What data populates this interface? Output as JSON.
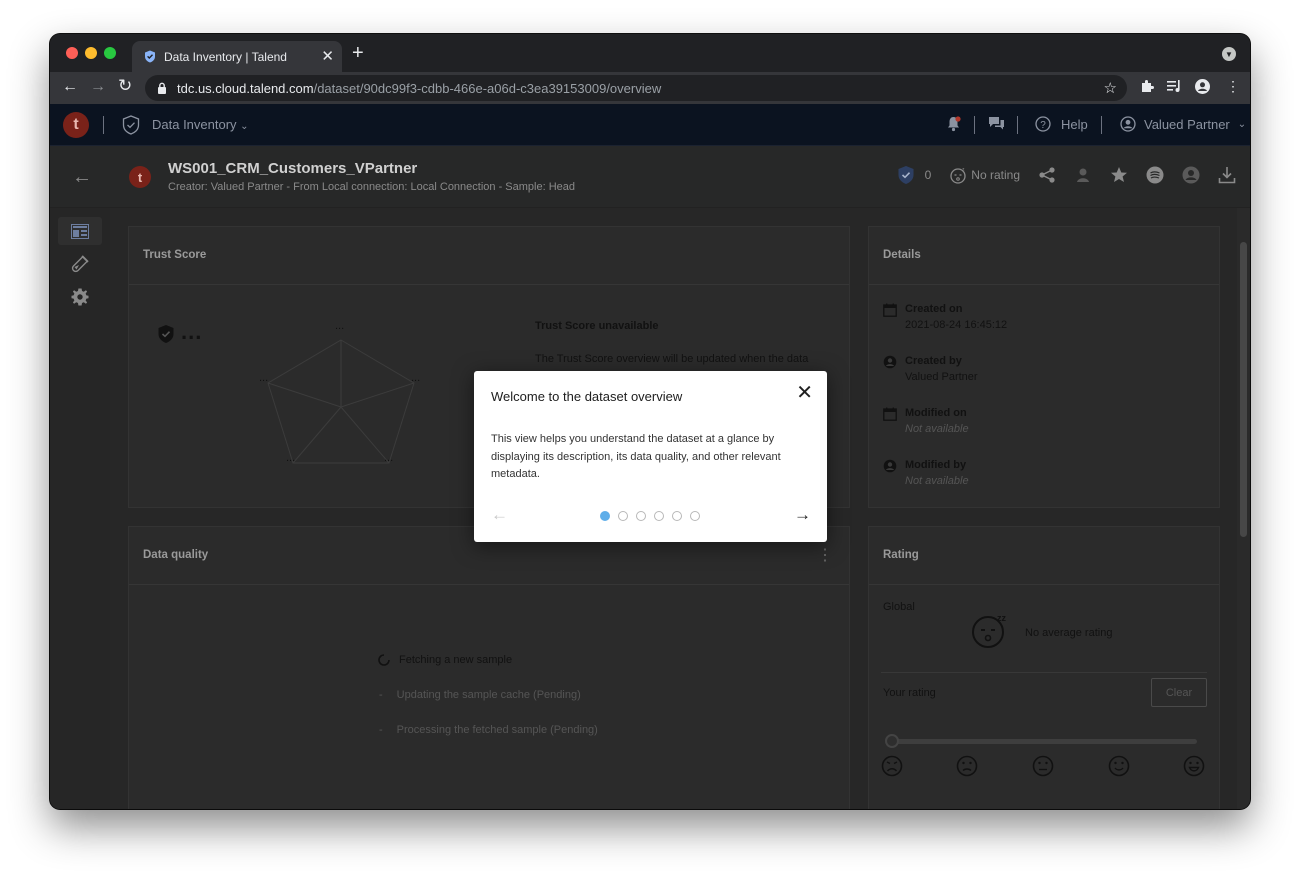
{
  "browser": {
    "tab_title": "Data Inventory | Talend",
    "url_host": "tdc.us.cloud.talend.com",
    "url_path": "/dataset/90dc99f3-cdbb-466e-a06d-c3ea39153009/overview",
    "traffic_lights": [
      "#fe5f57",
      "#febc2e",
      "#28c840"
    ]
  },
  "appbar": {
    "logo": "t",
    "app_name": "Data Inventory",
    "help": "Help",
    "user": "Valued Partner"
  },
  "dataset": {
    "logo": "t",
    "title": "WS001_CRM_Customers_VPartner",
    "subtitle": "Creator: Valued Partner - From Local connection: Local Connection - Sample: Head",
    "certification_count": "0",
    "rating": "No rating"
  },
  "trust_score": {
    "title": "Trust Score",
    "score": "...",
    "axis_values": [
      "...",
      "...",
      "...",
      "...",
      "..."
    ],
    "unavailable_title": "Trust Score unavailable",
    "unavailable_text": "The Trust Score overview will be updated when the data"
  },
  "details": {
    "title": "Details",
    "items": [
      {
        "label": "Created on",
        "value": "2021-08-24 16:45:12",
        "icon": "calendar-icon"
      },
      {
        "label": "Created by",
        "value": "Valued Partner",
        "icon": "user-icon"
      },
      {
        "label": "Modified on",
        "value": "Not available",
        "icon": "calendar-icon"
      },
      {
        "label": "Modified by",
        "value": "Not available",
        "icon": "user-icon"
      }
    ]
  },
  "data_quality": {
    "title": "Data quality",
    "steps": [
      "Fetching a new sample",
      "Updating the sample cache (Pending)",
      "Processing the fetched sample (Pending)"
    ]
  },
  "rating": {
    "title": "Rating",
    "global_label": "Global",
    "no_average": "No average rating",
    "your_rating": "Your rating",
    "clear": "Clear",
    "slider_value": 0
  },
  "modal": {
    "title": "Welcome to the dataset overview",
    "body": "This view helps you understand the dataset at a glance by displaying its description, its data quality, and other relevant metadata.",
    "current_page": 1,
    "page_count": 6
  }
}
